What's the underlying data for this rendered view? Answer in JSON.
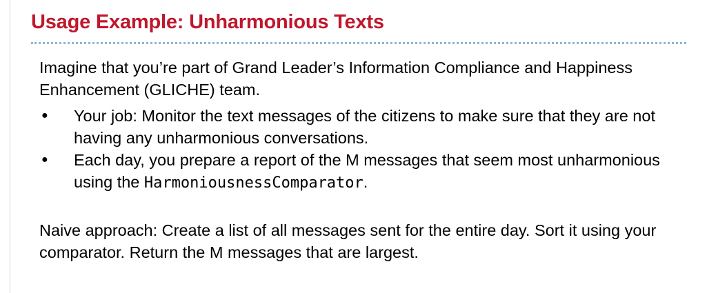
{
  "slide": {
    "title": "Usage Example: Unharmonious Texts",
    "intro": "Imagine that you’re part of Grand Leader’s Information Compliance and Happiness Enhancement (GLICHE) team.",
    "bullets": [
      {
        "text": "Your job: Monitor the text messages of the citizens to make sure that they are not having any unharmonious conversations."
      },
      {
        "text_before": "Each day, you prepare a report of the M messages that seem most unharmonious using the ",
        "code": "HarmoniousnessComparator",
        "text_after": "."
      }
    ],
    "naive": "Naive approach: Create a list of all messages sent for the entire day. Sort it using your comparator. Return the M messages that are largest.",
    "bullet_glyph": "●"
  },
  "colors": {
    "title": "#c0172c",
    "divider": "#8fb4dc"
  }
}
